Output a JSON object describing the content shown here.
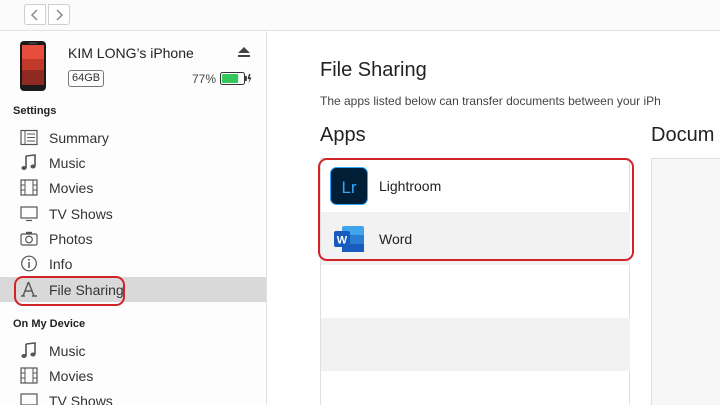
{
  "device": {
    "name": "KIM LONG’s iPhone",
    "capacity": "64GB",
    "battery_percent": "77%",
    "battery_level": 0.77
  },
  "sidebar": {
    "settings_label": "Settings",
    "settings_items": [
      {
        "label": "Summary",
        "icon": "summary-icon"
      },
      {
        "label": "Music",
        "icon": "music-note-icon"
      },
      {
        "label": "Movies",
        "icon": "film-icon"
      },
      {
        "label": "TV Shows",
        "icon": "tv-icon"
      },
      {
        "label": "Photos",
        "icon": "camera-icon"
      },
      {
        "label": "Info",
        "icon": "info-icon"
      },
      {
        "label": "File Sharing",
        "icon": "file-sharing-icon",
        "selected": true
      }
    ],
    "on_device_label": "On My Device",
    "on_device_items": [
      {
        "label": "Music",
        "icon": "music-note-icon"
      },
      {
        "label": "Movies",
        "icon": "film-icon"
      },
      {
        "label": "TV Shows",
        "icon": "tv-icon"
      }
    ]
  },
  "main": {
    "title": "File Sharing",
    "description": "The apps listed below can transfer documents between your iPh",
    "apps_title": "Apps",
    "documents_title": "Docum",
    "apps": [
      {
        "name": "Lightroom",
        "icon": "lightroom-icon"
      },
      {
        "name": "Word",
        "icon": "word-icon"
      }
    ]
  },
  "colors": {
    "highlight": "#d0232a",
    "selected_row": "#d9d9d9",
    "battery_green": "#34c759",
    "lightroom_bg": "#001e36",
    "lightroom_accent": "#31a8ff",
    "word_blue": "#185abd"
  }
}
